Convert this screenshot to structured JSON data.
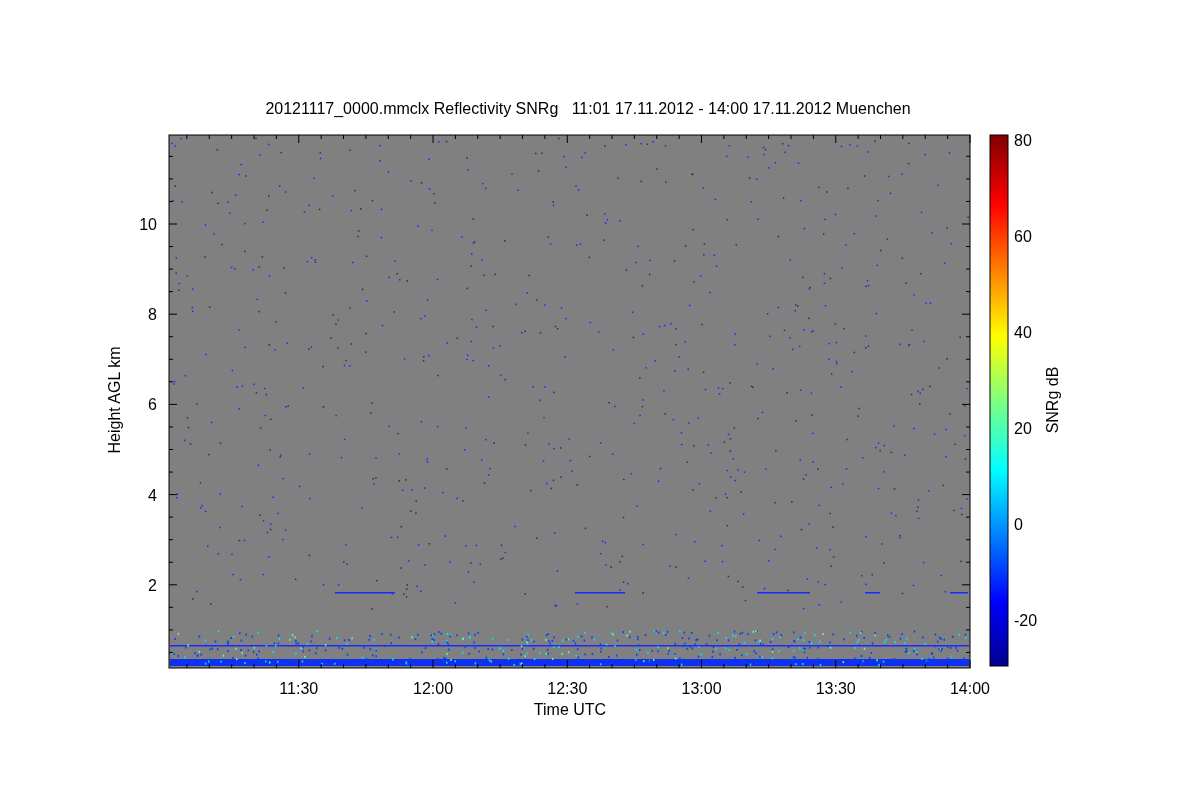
{
  "title": "20121117_0000.mmclx Reflectivity SNRg   11:01 17.11.2012 - 14:00 17.11.2012 Muenchen",
  "plot": {
    "xlabel": "Time UTC",
    "ylabel": "Height AGL km",
    "xticks": [
      "11:30",
      "12:00",
      "12:30",
      "13:00",
      "13:30",
      "14:00"
    ],
    "yticks": [
      "10",
      "8",
      "6",
      "4",
      "2"
    ]
  },
  "colorbar": {
    "label": "SNRg dB",
    "ticks": [
      "80",
      "60",
      "40",
      "20",
      "0",
      "-20"
    ]
  }
}
